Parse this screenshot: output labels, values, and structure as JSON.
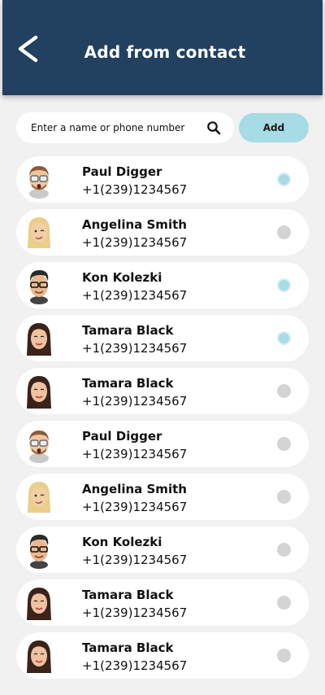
{
  "header": {
    "title": "Add from contact",
    "back_icon": "chevron-left-icon"
  },
  "search": {
    "placeholder": "Enter a name or phone number",
    "value": "",
    "icon": "search-icon"
  },
  "add_button": {
    "label": "Add"
  },
  "colors": {
    "header_bg": "#22405f",
    "accent": "#a7dbe6",
    "radio_off": "#d4d4d4",
    "page_bg": "#f1f1f1"
  },
  "contacts": [
    {
      "name": "Paul Digger",
      "phone": "+1(239)1234567",
      "selected": true,
      "avatar": "man-glasses-beard-avatar"
    },
    {
      "name": "Angelina Smith",
      "phone": "+1(239)1234567",
      "selected": false,
      "avatar": "blonde-woman-avatar"
    },
    {
      "name": "Kon Kolezki",
      "phone": "+1(239)1234567",
      "selected": true,
      "avatar": "man-dark-hair-glasses-avatar"
    },
    {
      "name": "Tamara Black",
      "phone": "+1(239)1234567",
      "selected": true,
      "avatar": "woman-dark-hair-avatar"
    },
    {
      "name": "Tamara Black",
      "phone": "+1(239)1234567",
      "selected": false,
      "avatar": "woman-dark-hair-avatar"
    },
    {
      "name": "Paul Digger",
      "phone": "+1(239)1234567",
      "selected": false,
      "avatar": "man-glasses-beard-avatar"
    },
    {
      "name": "Angelina Smith",
      "phone": "+1(239)1234567",
      "selected": false,
      "avatar": "blonde-woman-avatar"
    },
    {
      "name": "Kon Kolezki",
      "phone": "+1(239)1234567",
      "selected": false,
      "avatar": "man-dark-hair-glasses-avatar"
    },
    {
      "name": "Tamara Black",
      "phone": "+1(239)1234567",
      "selected": false,
      "avatar": "woman-dark-hair-avatar"
    },
    {
      "name": "Tamara Black",
      "phone": "+1(239)1234567",
      "selected": false,
      "avatar": "woman-dark-hair-avatar"
    }
  ]
}
